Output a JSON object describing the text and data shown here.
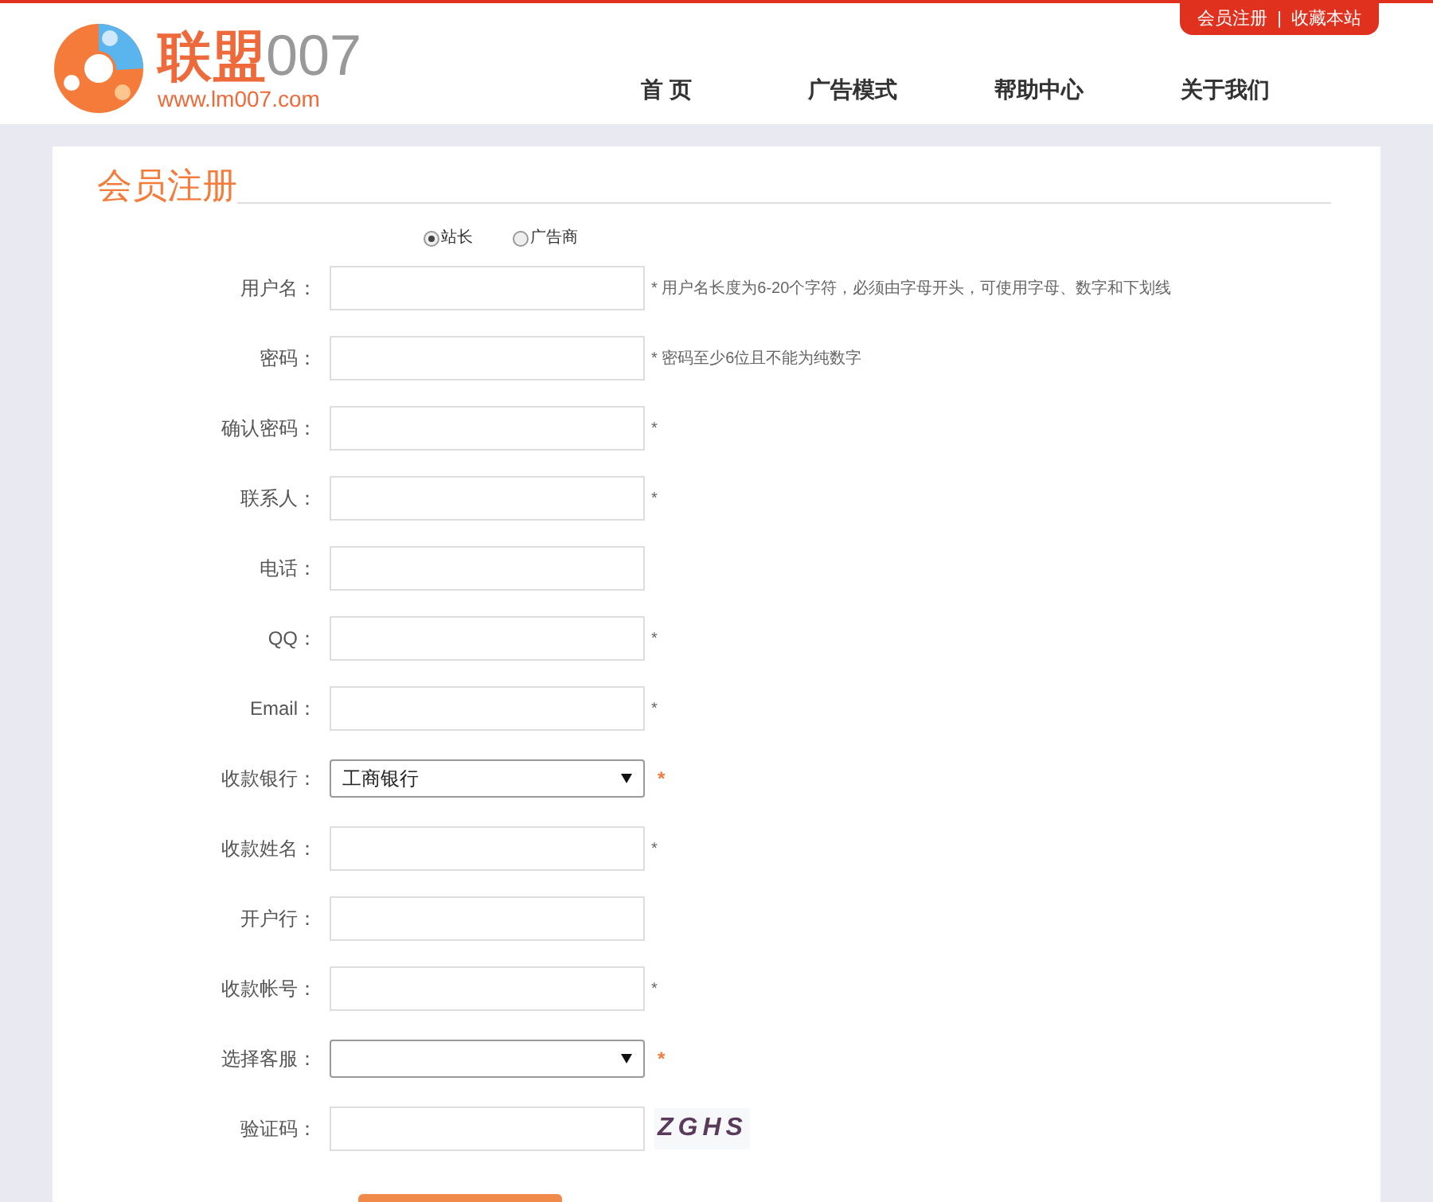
{
  "logo": {
    "brand_cn": "联盟",
    "brand_num": "007",
    "url": "www.lm007.com"
  },
  "top_links": [
    "会员注册",
    "|",
    "收藏本站"
  ],
  "nav": [
    "首 页",
    "广告模式",
    "帮助中心",
    "关于我们"
  ],
  "title": "会员注册",
  "role_options": [
    {
      "label": "站长",
      "selected": true
    },
    {
      "label": "广告商",
      "selected": false
    }
  ],
  "fields": [
    {
      "kind": "text",
      "label": "用户名：",
      "hint": "* 用户名长度为6-20个字符，必须由字母开头，可使用字母、数字和下划线"
    },
    {
      "kind": "text",
      "label": "密码：",
      "hint": "* 密码至少6位且不能为纯数字"
    },
    {
      "kind": "text",
      "label": "确认密码：",
      "hint": "*"
    },
    {
      "kind": "text",
      "label": "联系人：",
      "hint": "*"
    },
    {
      "kind": "text",
      "label": "电话："
    },
    {
      "kind": "text",
      "label": "QQ：",
      "hint": "*"
    },
    {
      "kind": "text",
      "label": "Email：",
      "hint": "*"
    },
    {
      "kind": "select",
      "label": "收款银行：",
      "value": "工商银行",
      "hint": "*"
    },
    {
      "kind": "text",
      "label": "收款姓名：",
      "hint": "*"
    },
    {
      "kind": "text",
      "label": "开户行："
    },
    {
      "kind": "text",
      "label": "收款帐号：",
      "hint": "*"
    },
    {
      "kind": "select",
      "label": "选择客服：",
      "hint": "*"
    },
    {
      "kind": "captcha",
      "label": "验证码：",
      "captcha": "ZGHS"
    }
  ]
}
